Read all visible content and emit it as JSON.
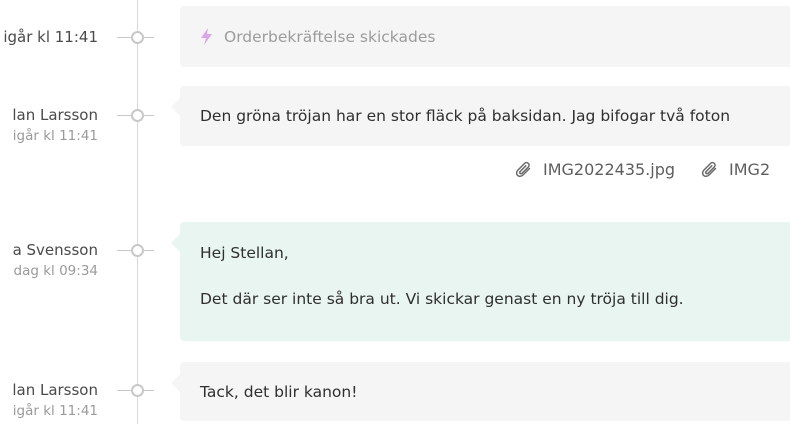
{
  "events": [
    {
      "type": "system",
      "time": "igår kl 11:41",
      "text": "Orderbekräftelse skickades"
    },
    {
      "type": "message",
      "author": "lan Larsson",
      "time": "igår kl 11:41",
      "text": "Den gröna tröjan har en stor fläck på baksidan. Jag bifogar två foton",
      "attachments": [
        "IMG2022435.jpg",
        "IMG2"
      ]
    },
    {
      "type": "message",
      "author": "a Svensson",
      "time": "dag kl 09:34",
      "greeting": "Hej Stellan,",
      "text": "Det där ser inte så bra ut. Vi skickar genast en ny tröja till dig.",
      "style": "teal"
    },
    {
      "type": "message",
      "author": "lan Larsson",
      "time": "igår kl 11:41",
      "text": "Tack, det blir kanon!"
    }
  ],
  "icons": {
    "system": "lightning-icon",
    "attachment": "paperclip-icon"
  },
  "colors": {
    "accent": "#d9a6e6",
    "teal_bubble": "#e9f5f1",
    "grey_bubble": "#f5f5f5"
  }
}
